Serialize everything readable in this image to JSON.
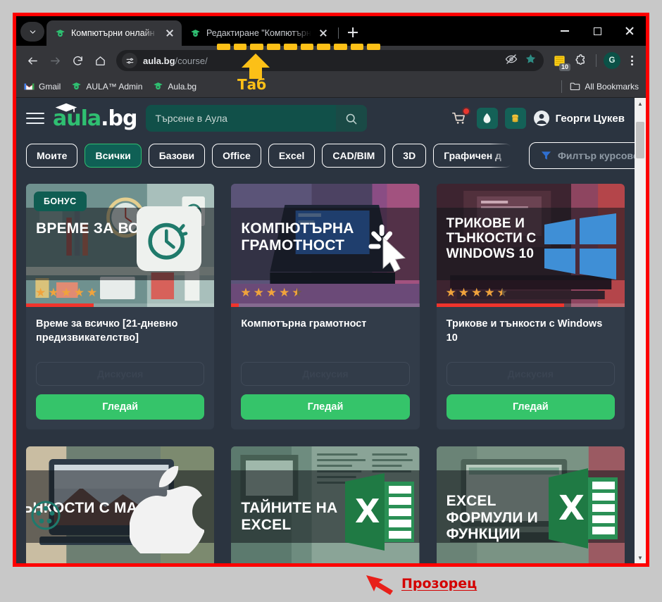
{
  "browser": {
    "tabs": [
      {
        "title": "Компютърни онлайн курсове",
        "favicon": "aula-icon",
        "active": true
      },
      {
        "title": "Редактиране \"Компютърна гра",
        "favicon": "aula-icon",
        "active": false
      }
    ],
    "new_tab_label": "+",
    "window_controls": {
      "minimize": "—",
      "maximize": "□",
      "close": "✕"
    },
    "nav": {
      "back": "←",
      "forward": "→",
      "reload": "⟳",
      "home": "⌂"
    },
    "omnibox": {
      "site_settings_icon": "tune-icon",
      "url_domain": "aula.bg",
      "url_path": "/course/",
      "no_tracking_icon": "eye-slash-icon",
      "bookmark_icon": "star-icon"
    },
    "extensions": {
      "badge_count": "10",
      "puzzle_icon": "extensions-icon"
    },
    "profile_initial": "G",
    "menu_icon": "kebab-menu-icon",
    "bookmarks": [
      {
        "label": "Gmail",
        "icon": "gmail-icon"
      },
      {
        "label": "AULA™ Admin",
        "icon": "aula-icon"
      },
      {
        "label": "Aula.bg",
        "icon": "aula-icon"
      }
    ],
    "all_bookmarks_label": "All Bookmarks"
  },
  "site": {
    "logo": {
      "primary": "aula",
      "secondary": ".bg"
    },
    "search": {
      "placeholder": "Търсене в Аула",
      "value": ""
    },
    "user_name": "Георги Цукев",
    "filters": [
      {
        "label": "Моите",
        "active": false
      },
      {
        "label": "Всички",
        "active": true
      },
      {
        "label": "Базови",
        "active": false
      },
      {
        "label": "Office",
        "active": false
      },
      {
        "label": "Excel",
        "active": false
      },
      {
        "label": "CAD/BIM",
        "active": false
      },
      {
        "label": "3D",
        "active": false
      },
      {
        "label": "Графичен д",
        "active": false
      }
    ],
    "filter_courses_label": "Филтър курсове",
    "courses": [
      {
        "badge": "БОНУС",
        "thumb_title": "ВРЕМЕ ЗА ВСИЧКО",
        "title": "Време за всичко [21-дневно предизвикателство]",
        "stars": 5,
        "half_star": false,
        "progress_percent": 36,
        "discussion_label": "Дискусия",
        "watch_label": "Гледай"
      },
      {
        "badge": "",
        "thumb_title": "КОМПЮТЪРНА ГРАМОТНОСТ",
        "title": "Компютърна грамотност",
        "stars": 4,
        "half_star": true,
        "progress_percent": 4,
        "discussion_label": "Дискусия",
        "watch_label": "Гледай"
      },
      {
        "badge": "",
        "thumb_title": "ТРИКОВЕ И ТЪНКОСТИ С WINDOWS 10",
        "title": "Трикове и тънкости с Windows 10",
        "stars": 4,
        "half_star": true,
        "progress_percent": 68,
        "discussion_label": "Дискусия",
        "watch_label": "Гледай"
      },
      {
        "badge": "",
        "thumb_title": "ТЪНКОСТИ С MAC OS",
        "title": "",
        "stars": 0,
        "half_star": false,
        "progress_percent": 0,
        "discussion_label": "",
        "watch_label": ""
      },
      {
        "badge": "",
        "thumb_title": "ТАЙНИТЕ НА EXCEL",
        "title": "",
        "stars": 0,
        "half_star": false,
        "progress_percent": 0,
        "discussion_label": "",
        "watch_label": ""
      },
      {
        "badge": "",
        "thumb_title": "EXCEL ФОРМУЛИ И ФУНКЦИИ",
        "title": "",
        "stars": 0,
        "half_star": false,
        "progress_percent": 0,
        "discussion_label": "",
        "watch_label": ""
      }
    ]
  },
  "annotations": {
    "tab_label": "Таб",
    "window_label": "Прозорец",
    "highlight_color": "#fcc017",
    "window_frame_color": "#fe0000",
    "arrow_red_color": "#e8201a"
  }
}
